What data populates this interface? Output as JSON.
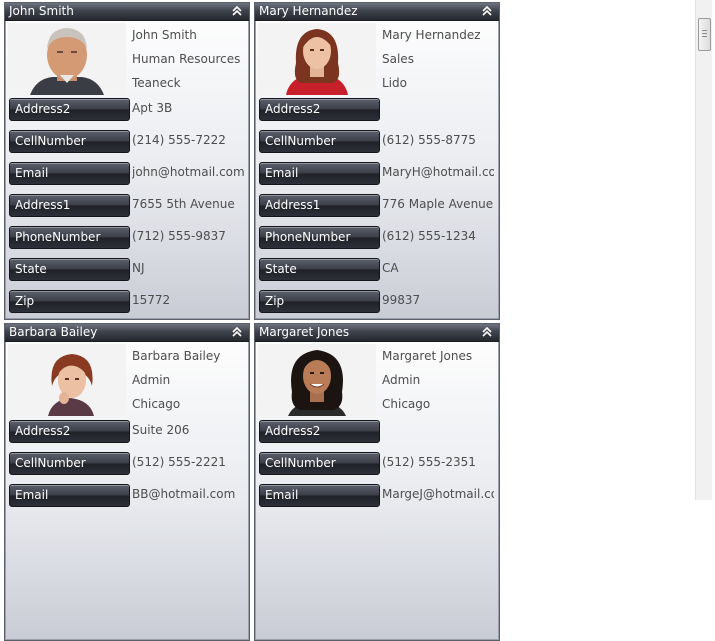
{
  "cards": [
    {
      "name": "John Smith",
      "info": [
        "John Smith",
        "Human Resources",
        "Teaneck"
      ],
      "fields": [
        {
          "label": "Address2",
          "value": "Apt 3B"
        },
        {
          "label": "CellNumber",
          "value": "(214) 555-7222"
        },
        {
          "label": "Email",
          "value": "john@hotmail.com"
        },
        {
          "label": "Address1",
          "value": "7655 5th Avenue"
        },
        {
          "label": "PhoneNumber",
          "value": "(712) 555-9837"
        },
        {
          "label": "State",
          "value": "NJ"
        },
        {
          "label": "Zip",
          "value": "15772"
        }
      ]
    },
    {
      "name": "Mary Hernandez",
      "info": [
        "Mary Hernandez",
        "Sales",
        "Lido"
      ],
      "fields": [
        {
          "label": "Address2",
          "value": ""
        },
        {
          "label": "CellNumber",
          "value": "(612) 555-8775"
        },
        {
          "label": "Email",
          "value": "MaryH@hotmail.com"
        },
        {
          "label": "Address1",
          "value": "776 Maple Avenue"
        },
        {
          "label": "PhoneNumber",
          "value": "(612) 555-1234"
        },
        {
          "label": "State",
          "value": "CA"
        },
        {
          "label": "Zip",
          "value": "99837"
        }
      ]
    },
    {
      "name": "Barbara Bailey",
      "info": [
        "Barbara Bailey",
        "Admin",
        "Chicago"
      ],
      "fields": [
        {
          "label": "Address2",
          "value": "Suite 206"
        },
        {
          "label": "CellNumber",
          "value": "(512) 555-2221"
        },
        {
          "label": "Email",
          "value": "BB@hotmail.com"
        }
      ]
    },
    {
      "name": "Margaret Jones",
      "info": [
        "Margaret Jones",
        "Admin",
        "Chicago"
      ],
      "fields": [
        {
          "label": "Address2",
          "value": ""
        },
        {
          "label": "CellNumber",
          "value": "(512) 555-2351"
        },
        {
          "label": "Email",
          "value": "MargeJ@hotmail.com"
        }
      ]
    }
  ],
  "icons": {
    "collapse": "chevron-double-up-icon",
    "photo": "person-photo"
  }
}
